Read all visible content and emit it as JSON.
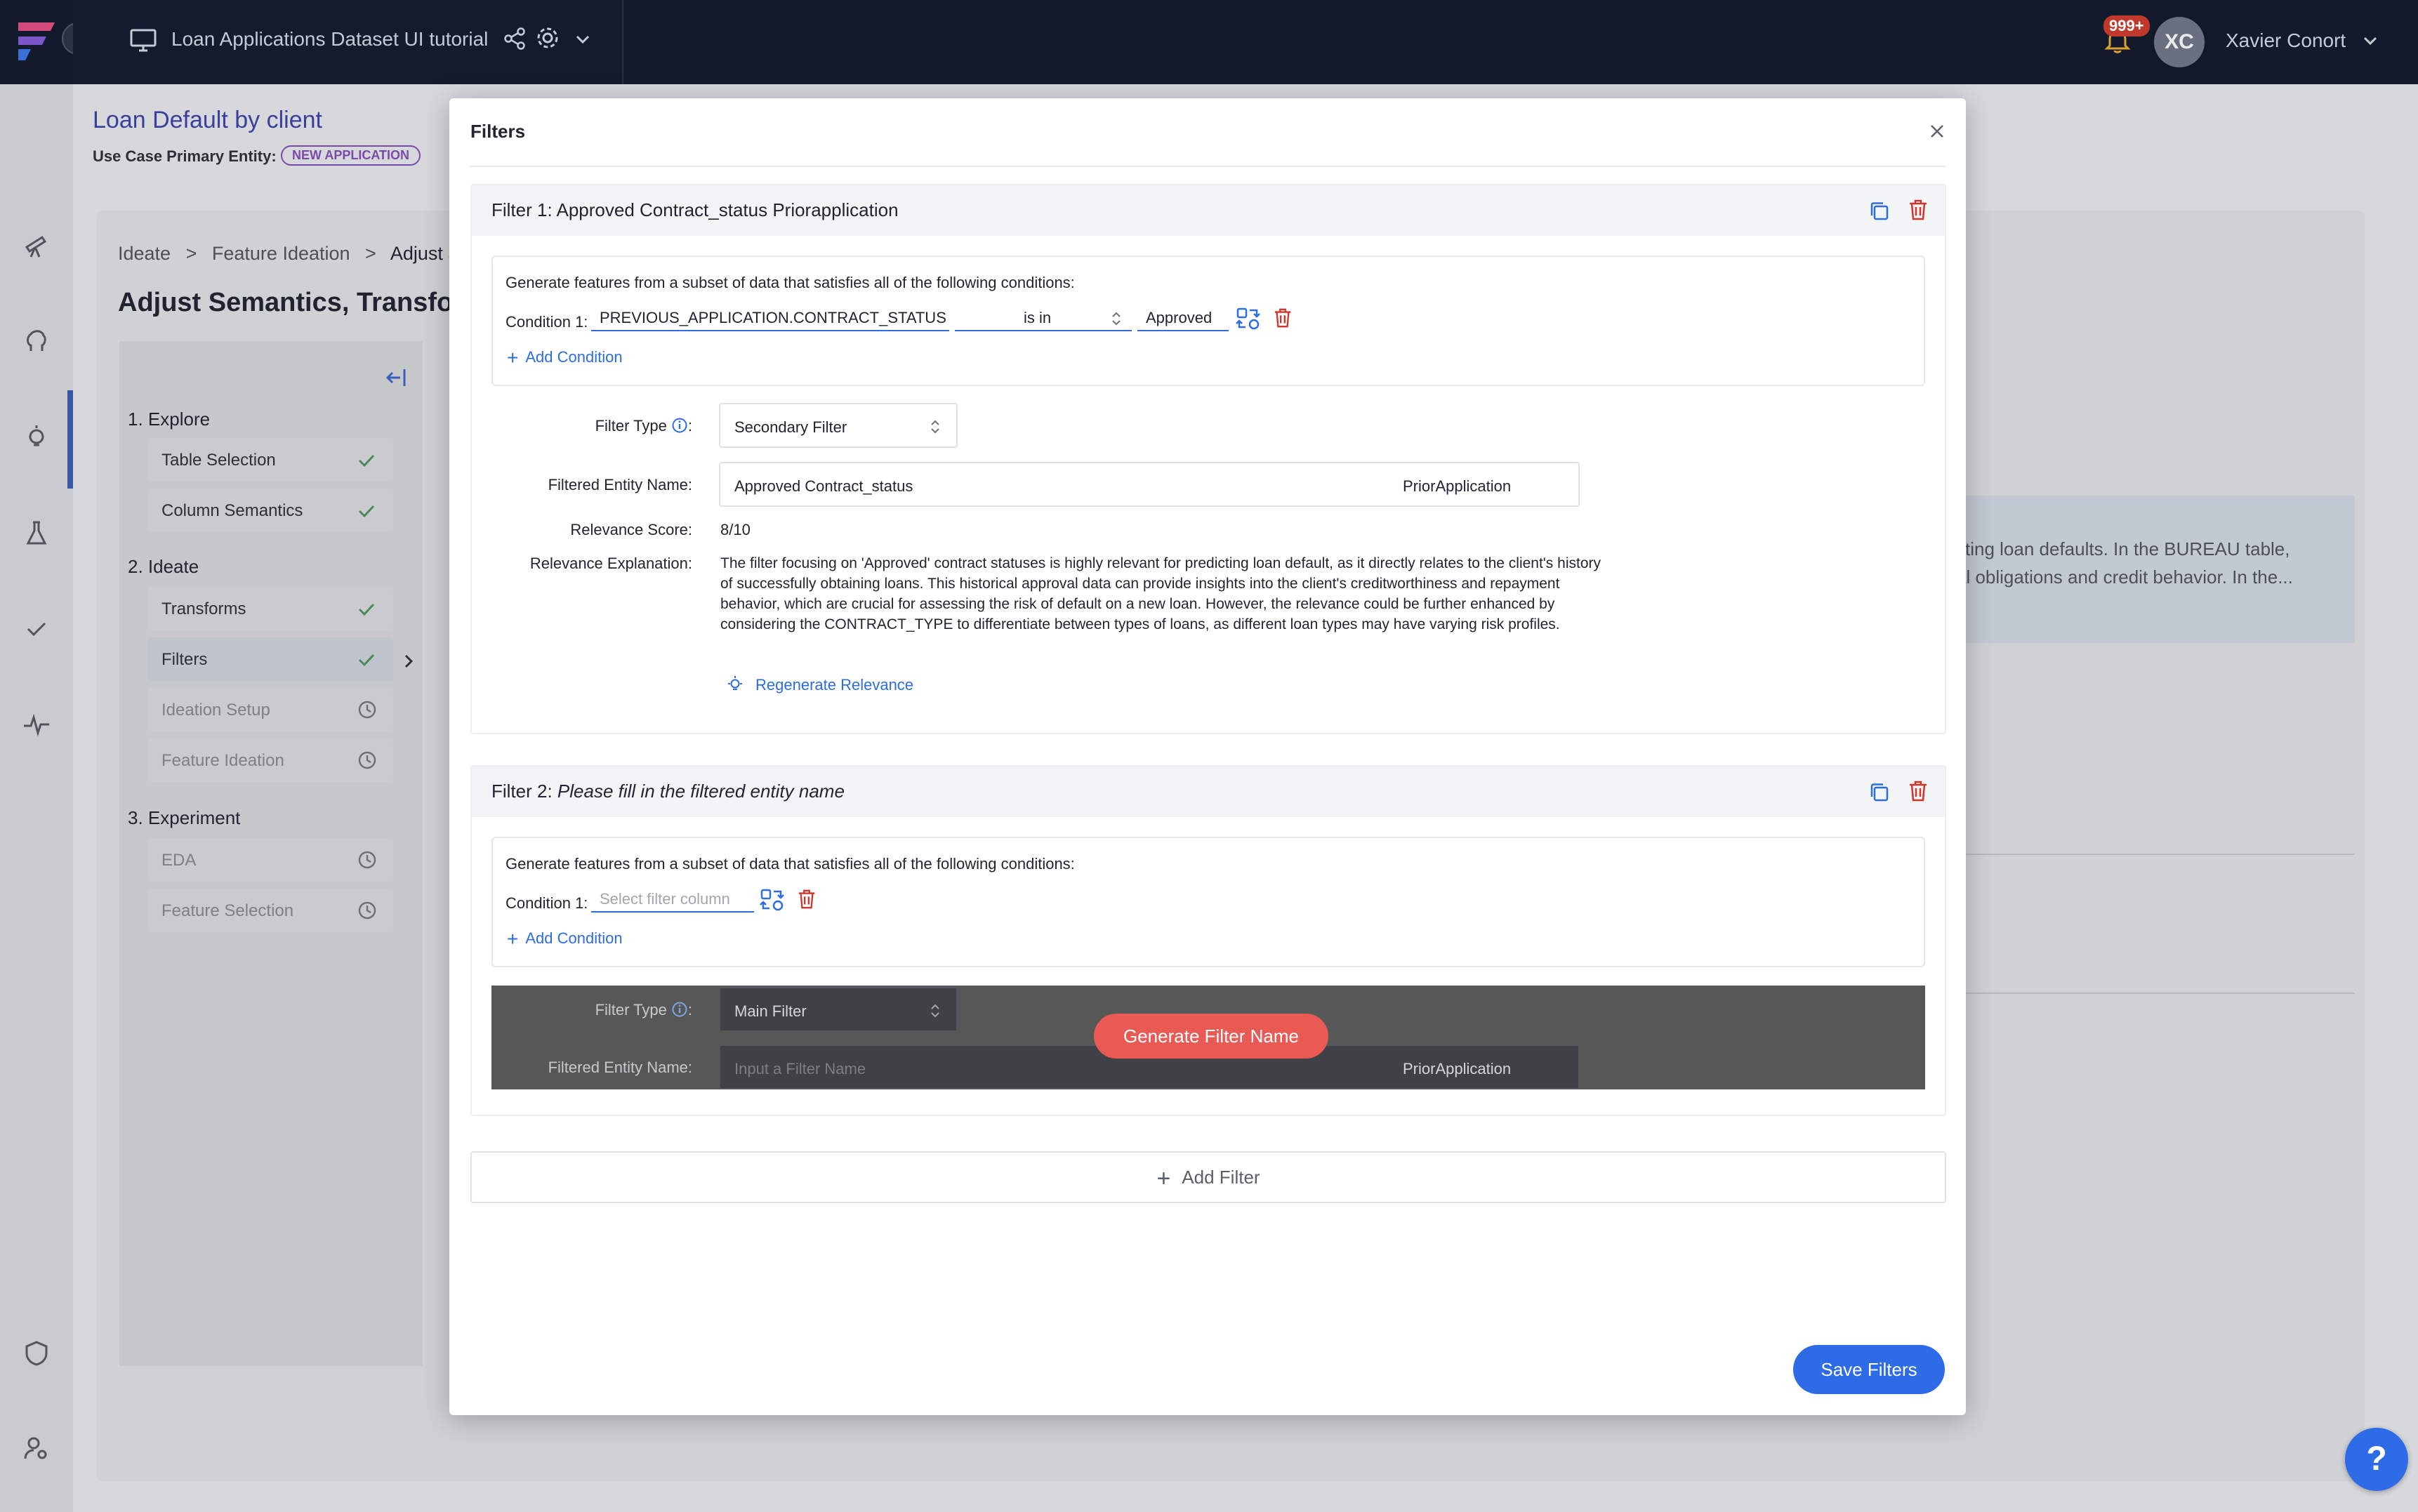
{
  "app": {
    "title": "Loan Applications Dataset UI tutorial",
    "notifications": "999+",
    "user_initials": "XC",
    "user_name": "Xavier Conort",
    "help_label": "?"
  },
  "page": {
    "title": "Loan Default by client",
    "primary_entity_label": "Use Case Primary Entity:",
    "primary_entity_badge": "NEW APPLICATION",
    "breadcrumb": [
      "Ideate",
      ">",
      "Feature Ideation",
      ">",
      "Adjust S"
    ],
    "section_title": "Adjust Semantics, Transfor"
  },
  "steps": {
    "explore": {
      "heading": "1. Explore",
      "items": [
        {
          "label": "Table Selection",
          "status": "done"
        },
        {
          "label": "Column Semantics",
          "status": "done"
        }
      ]
    },
    "ideate": {
      "heading": "2. Ideate",
      "items": [
        {
          "label": "Transforms",
          "status": "done"
        },
        {
          "label": "Filters",
          "status": "done"
        },
        {
          "label": "Ideation Setup",
          "status": "locked"
        },
        {
          "label": "Feature Ideation",
          "status": "locked"
        }
      ]
    },
    "experiment": {
      "heading": "3. Experiment",
      "items": [
        {
          "label": "EDA",
          "status": "locked"
        },
        {
          "label": "Feature Selection",
          "status": "locked"
        }
      ]
    }
  },
  "background_text": {
    "line1": "cting loan defaults. In the BUREAU table,",
    "line2": "al obligations and credit behavior. In the..."
  },
  "modal": {
    "title": "Filters",
    "filters": [
      {
        "header_prefix": "Filter 1:",
        "header_name": "Approved Contract_status Priorapplication",
        "conditions_intro": "Generate features from a subset of data that satisfies all of the following conditions:",
        "condition_label": "Condition 1:",
        "condition_column": "PREVIOUS_APPLICATION.CONTRACT_STATUS",
        "condition_operator": "is in",
        "condition_value": "Approved",
        "add_condition": "Add Condition",
        "filter_type_label": "Filter Type",
        "filter_type_value": "Secondary Filter",
        "entity_name_label": "Filtered Entity Name:",
        "entity_name_value": "Approved Contract_status",
        "entity_suffix": "PriorApplication",
        "relevance_score_label": "Relevance Score:",
        "relevance_score": "8/10",
        "relevance_expl_label": "Relevance Explanation:",
        "relevance_explanation": "The filter focusing on 'Approved' contract statuses is highly relevant for predicting loan default, as it directly relates to the client's history of successfully obtaining loans. This historical approval data can provide insights into the client's creditworthiness and repayment behavior, which are crucial for assessing the risk of default on a new loan. However, the relevance could be further enhanced by considering the CONTRACT_TYPE to differentiate between types of loans, as different loan types may have varying risk profiles.",
        "regenerate_label": "Regenerate Relevance"
      },
      {
        "header_prefix": "Filter 2:",
        "header_name": "Please fill in the filtered entity name",
        "conditions_intro": "Generate features from a subset of data that satisfies all of the following conditions:",
        "condition_label": "Condition 1:",
        "condition_placeholder": "Select filter column",
        "add_condition": "Add Condition",
        "filter_type_label": "Filter Type",
        "filter_type_value": "Main Filter",
        "entity_name_label": "Filtered Entity Name:",
        "entity_name_placeholder": "Input a Filter Name",
        "entity_suffix": "PriorApplication",
        "generate_name_button": "Generate Filter Name"
      }
    ],
    "add_filter": "Add Filter",
    "save_button": "Save Filters"
  },
  "colors": {
    "topbar": "#121a2c",
    "accent_blue": "#2e6be6",
    "danger_red": "#d0342c",
    "generate_button": "#ea5a55",
    "page_title": "#3b3f9c",
    "badge_purple": "#7a4aa8"
  },
  "icons": [
    "logo-icon",
    "chevron-right-icon",
    "monitor-icon",
    "share-icon",
    "gear-icon",
    "chevron-down-icon",
    "bell-icon",
    "close-icon",
    "copy-icon",
    "trash-icon",
    "swap-icon",
    "info-icon",
    "sort-icon",
    "bulb-icon",
    "plus-icon",
    "check-icon",
    "clock-icon",
    "collapse-left-icon"
  ]
}
